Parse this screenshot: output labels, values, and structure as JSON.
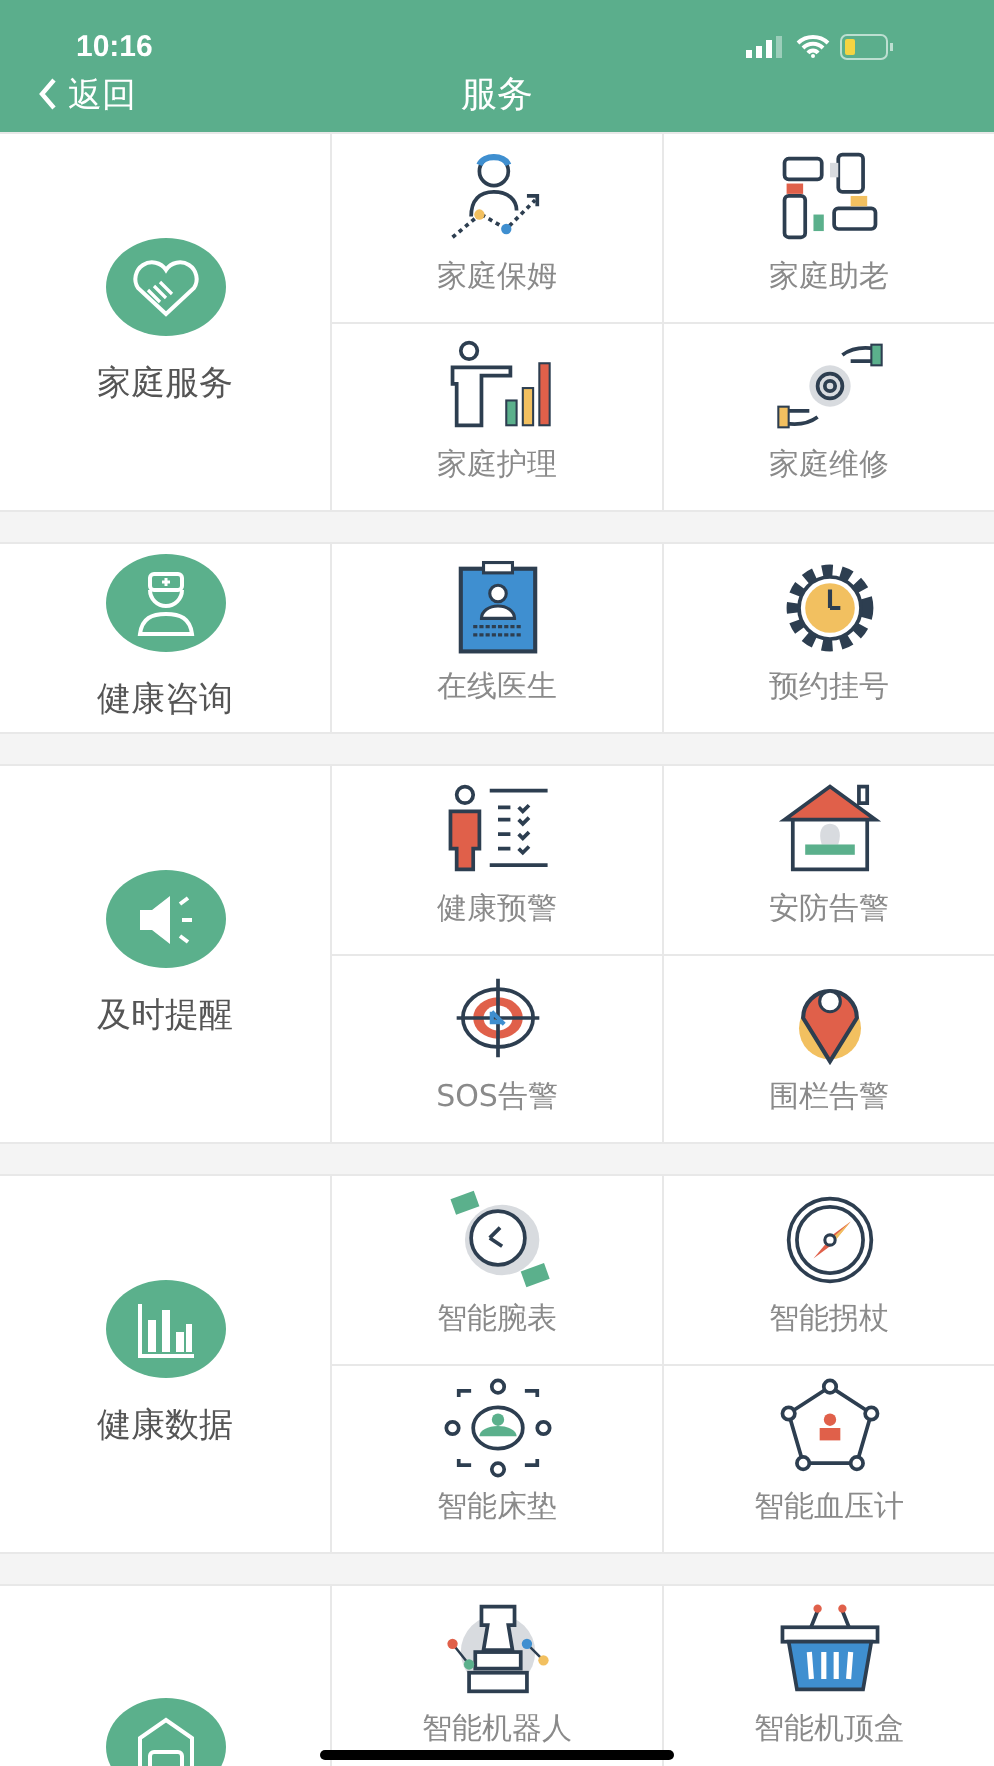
{
  "status_bar": {
    "time": "10:16"
  },
  "nav": {
    "back": "返回",
    "title": "服务"
  },
  "sections": [
    {
      "label": "家庭服务",
      "items": [
        {
          "label": "家庭保姆"
        },
        {
          "label": "家庭助老"
        },
        {
          "label": "家庭护理"
        },
        {
          "label": "家庭维修"
        }
      ]
    },
    {
      "label": "健康咨询",
      "items": [
        {
          "label": "在线医生"
        },
        {
          "label": "预约挂号"
        }
      ]
    },
    {
      "label": "及时提醒",
      "items": [
        {
          "label": "健康预警"
        },
        {
          "label": "安防告警"
        },
        {
          "label": "SOS告警"
        },
        {
          "label": "围栏告警"
        }
      ]
    },
    {
      "label": "健康数据",
      "items": [
        {
          "label": "智能腕表"
        },
        {
          "label": "智能拐杖"
        },
        {
          "label": "智能床垫"
        },
        {
          "label": "智能血压计"
        }
      ]
    },
    {
      "items": [
        {
          "label": "智能机器人"
        },
        {
          "label": "智能机顶盒"
        }
      ]
    }
  ]
}
